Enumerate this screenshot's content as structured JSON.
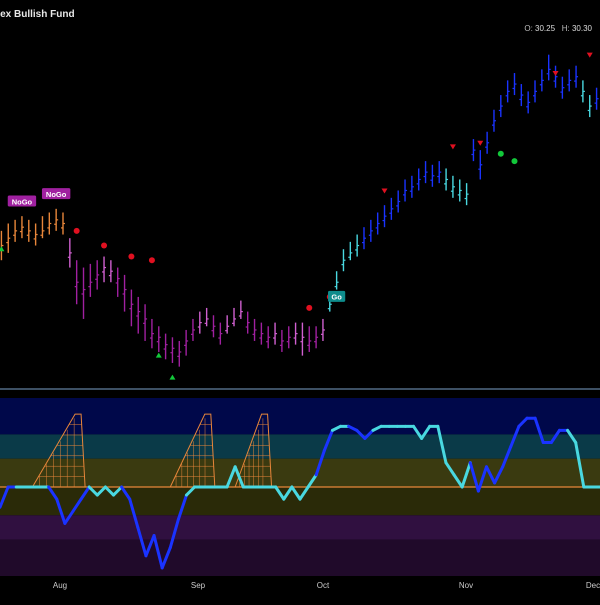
{
  "header": {
    "title": "dex Bullish Fund",
    "ohlc": {
      "o_label": "O:",
      "o_value": "30.25",
      "h_label": "H:",
      "h_value": "30.30"
    }
  },
  "colors": {
    "background": "#000000",
    "go_strong": "#1a33ff",
    "go_weak": "#49d8e0",
    "nogo_strong": "#a020a0",
    "nogo_weak": "#d060d0",
    "neutral": "#e8863a",
    "oscillator_zero": "#e8863a",
    "marker_red": "#e01020",
    "marker_green": "#12c83a",
    "divider": "#7aa0c8"
  },
  "chart_data": [
    {
      "type": "line",
      "x_tick_labels": [
        "Aug",
        "Sep",
        "Oct",
        "Nov",
        "Dec"
      ],
      "price_bars": [
        {
          "c": 14,
          "hi": 16,
          "lo": 12,
          "color": "neutral"
        },
        {
          "c": 15,
          "hi": 17,
          "lo": 13,
          "color": "neutral"
        },
        {
          "c": 16,
          "hi": 17.5,
          "lo": 14.5,
          "color": "neutral"
        },
        {
          "c": 16.5,
          "hi": 18,
          "lo": 15,
          "color": "neutral"
        },
        {
          "c": 16,
          "hi": 17.5,
          "lo": 14.5,
          "color": "neutral"
        },
        {
          "c": 15.5,
          "hi": 17,
          "lo": 14,
          "color": "neutral"
        },
        {
          "c": 16,
          "hi": 18,
          "lo": 15,
          "color": "neutral"
        },
        {
          "c": 17,
          "hi": 18.5,
          "lo": 15.5,
          "color": "neutral"
        },
        {
          "c": 17.5,
          "hi": 19,
          "lo": 16,
          "color": "neutral"
        },
        {
          "c": 17,
          "hi": 18.5,
          "lo": 15.5,
          "color": "neutral"
        },
        {
          "c": 13,
          "hi": 15,
          "lo": 11,
          "color": "nogo_weak"
        },
        {
          "c": 9,
          "hi": 12,
          "lo": 6,
          "color": "nogo_strong"
        },
        {
          "c": 8,
          "hi": 11,
          "lo": 4,
          "color": "nogo_strong"
        },
        {
          "c": 9,
          "hi": 11.5,
          "lo": 7,
          "color": "nogo_strong"
        },
        {
          "c": 10,
          "hi": 12,
          "lo": 8,
          "color": "nogo_strong"
        },
        {
          "c": 11,
          "hi": 12.5,
          "lo": 9,
          "color": "nogo_weak"
        },
        {
          "c": 10.5,
          "hi": 12,
          "lo": 9,
          "color": "nogo_weak"
        },
        {
          "c": 9.5,
          "hi": 11,
          "lo": 7,
          "color": "nogo_strong"
        },
        {
          "c": 8,
          "hi": 10,
          "lo": 5,
          "color": "nogo_strong"
        },
        {
          "c": 6,
          "hi": 8,
          "lo": 3,
          "color": "nogo_strong"
        },
        {
          "c": 5,
          "hi": 7,
          "lo": 2,
          "color": "nogo_strong"
        },
        {
          "c": 4,
          "hi": 6,
          "lo": 1,
          "color": "nogo_strong"
        },
        {
          "c": 2,
          "hi": 4,
          "lo": 0,
          "color": "nogo_strong"
        },
        {
          "c": 1.5,
          "hi": 3,
          "lo": -0.5,
          "color": "nogo_strong"
        },
        {
          "c": 0.5,
          "hi": 2,
          "lo": -1.5,
          "color": "nogo_strong"
        },
        {
          "c": 0,
          "hi": 1.5,
          "lo": -2,
          "color": "nogo_strong"
        },
        {
          "c": -0.5,
          "hi": 1,
          "lo": -2.5,
          "color": "nogo_strong"
        },
        {
          "c": 1,
          "hi": 2.5,
          "lo": -1,
          "color": "nogo_strong"
        },
        {
          "c": 2.5,
          "hi": 4,
          "lo": 1,
          "color": "nogo_strong"
        },
        {
          "c": 3.5,
          "hi": 5,
          "lo": 2,
          "color": "nogo_weak"
        },
        {
          "c": 4,
          "hi": 5.5,
          "lo": 3,
          "color": "nogo_weak"
        },
        {
          "c": 3,
          "hi": 4.5,
          "lo": 1.5,
          "color": "nogo_strong"
        },
        {
          "c": 2,
          "hi": 3.5,
          "lo": 0.5,
          "color": "nogo_strong"
        },
        {
          "c": 3,
          "hi": 4.5,
          "lo": 2,
          "color": "nogo_weak"
        },
        {
          "c": 4,
          "hi": 5.5,
          "lo": 3,
          "color": "nogo_weak"
        },
        {
          "c": 5,
          "hi": 6.5,
          "lo": 4,
          "color": "nogo_weak"
        },
        {
          "c": 3.5,
          "hi": 5,
          "lo": 2,
          "color": "nogo_strong"
        },
        {
          "c": 2.5,
          "hi": 4,
          "lo": 1,
          "color": "nogo_strong"
        },
        {
          "c": 2,
          "hi": 3.5,
          "lo": 0.5,
          "color": "nogo_strong"
        },
        {
          "c": 1.5,
          "hi": 3,
          "lo": 0,
          "color": "nogo_strong"
        },
        {
          "c": 2,
          "hi": 3.5,
          "lo": 0.5,
          "color": "nogo_weak"
        },
        {
          "c": 1,
          "hi": 2.5,
          "lo": -0.5,
          "color": "nogo_strong"
        },
        {
          "c": 1.5,
          "hi": 3,
          "lo": 0,
          "color": "nogo_strong"
        },
        {
          "c": 2,
          "hi": 3.5,
          "lo": 0.5,
          "color": "nogo_weak"
        },
        {
          "c": 1.5,
          "hi": 3.5,
          "lo": -1,
          "color": "nogo_weak"
        },
        {
          "c": 1,
          "hi": 3,
          "lo": -0.5,
          "color": "nogo_strong"
        },
        {
          "c": 1.5,
          "hi": 3,
          "lo": 0,
          "color": "nogo_strong"
        },
        {
          "c": 2.5,
          "hi": 4,
          "lo": 1,
          "color": "nogo_weak"
        },
        {
          "c": 6,
          "hi": 7.5,
          "lo": 5,
          "color": "go_weak"
        },
        {
          "c": 9,
          "hi": 10.5,
          "lo": 8,
          "color": "go_weak"
        },
        {
          "c": 12,
          "hi": 13.5,
          "lo": 10.5,
          "color": "go_weak"
        },
        {
          "c": 13,
          "hi": 14.5,
          "lo": 12,
          "color": "go_weak"
        },
        {
          "c": 14,
          "hi": 15.5,
          "lo": 12.5,
          "color": "go_weak"
        },
        {
          "c": 15,
          "hi": 16.5,
          "lo": 13.5,
          "color": "go_strong"
        },
        {
          "c": 16,
          "hi": 17.5,
          "lo": 14.5,
          "color": "go_strong"
        },
        {
          "c": 17,
          "hi": 18.5,
          "lo": 15.5,
          "color": "go_strong"
        },
        {
          "c": 18,
          "hi": 19.5,
          "lo": 16.5,
          "color": "go_strong"
        },
        {
          "c": 19,
          "hi": 20.5,
          "lo": 17.5,
          "color": "go_strong"
        },
        {
          "c": 20,
          "hi": 21.5,
          "lo": 18.5,
          "color": "go_strong"
        },
        {
          "c": 21.5,
          "hi": 23,
          "lo": 20,
          "color": "go_strong"
        },
        {
          "c": 22,
          "hi": 23.5,
          "lo": 20.5,
          "color": "go_strong"
        },
        {
          "c": 23,
          "hi": 24.5,
          "lo": 21.5,
          "color": "go_strong"
        },
        {
          "c": 24,
          "hi": 25.5,
          "lo": 22.5,
          "color": "go_strong"
        },
        {
          "c": 23.5,
          "hi": 25,
          "lo": 22,
          "color": "go_strong"
        },
        {
          "c": 24,
          "hi": 25.5,
          "lo": 22.5,
          "color": "go_strong"
        },
        {
          "c": 23,
          "hi": 24.5,
          "lo": 21.5,
          "color": "go_weak"
        },
        {
          "c": 22,
          "hi": 23.5,
          "lo": 20.5,
          "color": "go_weak"
        },
        {
          "c": 21.5,
          "hi": 23,
          "lo": 20,
          "color": "go_weak"
        },
        {
          "c": 21,
          "hi": 22.5,
          "lo": 19.5,
          "color": "go_weak"
        },
        {
          "c": 27,
          "hi": 28.5,
          "lo": 25.5,
          "color": "go_strong"
        },
        {
          "c": 25,
          "hi": 27,
          "lo": 23,
          "color": "go_strong"
        },
        {
          "c": 28,
          "hi": 29.5,
          "lo": 26.5,
          "color": "go_strong"
        },
        {
          "c": 31,
          "hi": 32.5,
          "lo": 29.5,
          "color": "go_strong"
        },
        {
          "c": 33,
          "hi": 34.5,
          "lo": 31.5,
          "color": "go_strong"
        },
        {
          "c": 35,
          "hi": 36.5,
          "lo": 33.5,
          "color": "go_strong"
        },
        {
          "c": 36,
          "hi": 37.5,
          "lo": 34.5,
          "color": "go_strong"
        },
        {
          "c": 34.5,
          "hi": 36,
          "lo": 33,
          "color": "go_strong"
        },
        {
          "c": 33.5,
          "hi": 35,
          "lo": 32,
          "color": "go_strong"
        },
        {
          "c": 35,
          "hi": 36.5,
          "lo": 33.5,
          "color": "go_strong"
        },
        {
          "c": 36.5,
          "hi": 38,
          "lo": 35,
          "color": "go_strong"
        },
        {
          "c": 38,
          "hi": 40,
          "lo": 36.5,
          "color": "go_strong"
        },
        {
          "c": 37,
          "hi": 38.5,
          "lo": 35.5,
          "color": "go_strong"
        },
        {
          "c": 35.5,
          "hi": 37,
          "lo": 34,
          "color": "go_strong"
        },
        {
          "c": 36.5,
          "hi": 38,
          "lo": 35,
          "color": "go_strong"
        },
        {
          "c": 37,
          "hi": 38.5,
          "lo": 35.5,
          "color": "go_strong"
        },
        {
          "c": 35,
          "hi": 36.5,
          "lo": 33.5,
          "color": "go_weak"
        },
        {
          "c": 33,
          "hi": 34.5,
          "lo": 31.5,
          "color": "go_weak"
        },
        {
          "c": 34,
          "hi": 35.5,
          "lo": 32.5,
          "color": "go_strong"
        }
      ],
      "labels": [
        {
          "text": "NoGo",
          "bar": 3,
          "price": 20,
          "color": "nogo_strong"
        },
        {
          "text": "NoGo",
          "bar": 8,
          "price": 21,
          "color": "nogo_strong"
        },
        {
          "text": "Go",
          "bar": 49,
          "price": 7,
          "color": "go_teal"
        }
      ],
      "markers": [
        {
          "bar": 11,
          "price": 16,
          "shape": "circle",
          "color": "marker_red"
        },
        {
          "bar": 15,
          "price": 14,
          "shape": "circle",
          "color": "marker_red"
        },
        {
          "bar": 19,
          "price": 12.5,
          "shape": "circle",
          "color": "marker_red"
        },
        {
          "bar": 22,
          "price": 12,
          "shape": "circle",
          "color": "marker_red"
        },
        {
          "bar": 45,
          "price": 5.5,
          "shape": "circle",
          "color": "marker_red"
        },
        {
          "bar": 48,
          "price": 7,
          "shape": "circle",
          "color": "marker_red"
        },
        {
          "bar": 56,
          "price": 21.5,
          "shape": "triangle-down",
          "color": "marker_red"
        },
        {
          "bar": 66,
          "price": 27.5,
          "shape": "triangle-down",
          "color": "marker_red"
        },
        {
          "bar": 70,
          "price": 28,
          "shape": "triangle-down",
          "color": "marker_red"
        },
        {
          "bar": 73,
          "price": 26.5,
          "shape": "circle",
          "color": "marker_green"
        },
        {
          "bar": 75,
          "price": 25.5,
          "shape": "circle",
          "color": "marker_green"
        },
        {
          "bar": 81,
          "price": 37.5,
          "shape": "triangle-down",
          "color": "marker_red"
        },
        {
          "bar": 86,
          "price": 40,
          "shape": "triangle-down",
          "color": "marker_red"
        },
        {
          "bar": 0,
          "price": 13.5,
          "shape": "triangle-up",
          "color": "marker_green"
        },
        {
          "bar": 23,
          "price": -1,
          "shape": "triangle-up",
          "color": "marker_green"
        },
        {
          "bar": 25,
          "price": -4,
          "shape": "triangle-up",
          "color": "marker_green"
        }
      ],
      "y_range": [
        -5,
        42
      ]
    },
    {
      "type": "line",
      "oscillator": [
        {
          "v": -0.5,
          "c": "go_strong"
        },
        {
          "v": 0,
          "c": "go_strong"
        },
        {
          "v": 0,
          "c": "go_strong"
        },
        {
          "v": 0,
          "c": "go_weak"
        },
        {
          "v": 0,
          "c": "go_weak"
        },
        {
          "v": 0,
          "c": "go_weak"
        },
        {
          "v": 0,
          "c": "go_weak"
        },
        {
          "v": -0.3,
          "c": "go_strong"
        },
        {
          "v": -0.9,
          "c": "go_strong"
        },
        {
          "v": -0.6,
          "c": "go_strong"
        },
        {
          "v": -0.3,
          "c": "go_strong"
        },
        {
          "v": 0,
          "c": "go_strong"
        },
        {
          "v": -0.2,
          "c": "go_weak"
        },
        {
          "v": 0,
          "c": "go_weak"
        },
        {
          "v": -0.2,
          "c": "go_weak"
        },
        {
          "v": 0,
          "c": "go_weak"
        },
        {
          "v": -0.3,
          "c": "go_strong"
        },
        {
          "v": -1.0,
          "c": "go_strong"
        },
        {
          "v": -1.7,
          "c": "go_strong"
        },
        {
          "v": -1.2,
          "c": "go_strong"
        },
        {
          "v": -2.0,
          "c": "go_strong"
        },
        {
          "v": -1.5,
          "c": "go_strong"
        },
        {
          "v": -0.8,
          "c": "go_strong"
        },
        {
          "v": -0.2,
          "c": "go_strong"
        },
        {
          "v": 0,
          "c": "go_weak"
        },
        {
          "v": 0,
          "c": "go_weak"
        },
        {
          "v": 0,
          "c": "go_weak"
        },
        {
          "v": 0,
          "c": "go_weak"
        },
        {
          "v": 0,
          "c": "go_weak"
        },
        {
          "v": 0.5,
          "c": "go_weak"
        },
        {
          "v": 0,
          "c": "go_weak"
        },
        {
          "v": 0,
          "c": "go_weak"
        },
        {
          "v": 0,
          "c": "go_weak"
        },
        {
          "v": 0,
          "c": "go_weak"
        },
        {
          "v": 0,
          "c": "go_weak"
        },
        {
          "v": -0.3,
          "c": "go_weak"
        },
        {
          "v": 0,
          "c": "go_weak"
        },
        {
          "v": -0.3,
          "c": "go_weak"
        },
        {
          "v": 0,
          "c": "go_weak"
        },
        {
          "v": 0.3,
          "c": "go_weak"
        },
        {
          "v": 0.9,
          "c": "go_strong"
        },
        {
          "v": 1.4,
          "c": "go_strong"
        },
        {
          "v": 1.5,
          "c": "go_weak"
        },
        {
          "v": 1.5,
          "c": "go_weak"
        },
        {
          "v": 1.4,
          "c": "go_strong"
        },
        {
          "v": 1.2,
          "c": "go_strong"
        },
        {
          "v": 1.4,
          "c": "go_strong"
        },
        {
          "v": 1.5,
          "c": "go_weak"
        },
        {
          "v": 1.5,
          "c": "go_weak"
        },
        {
          "v": 1.5,
          "c": "go_weak"
        },
        {
          "v": 1.5,
          "c": "go_weak"
        },
        {
          "v": 1.5,
          "c": "go_weak"
        },
        {
          "v": 1.2,
          "c": "go_weak"
        },
        {
          "v": 1.5,
          "c": "go_weak"
        },
        {
          "v": 1.5,
          "c": "go_weak"
        },
        {
          "v": 0.6,
          "c": "go_weak"
        },
        {
          "v": 0.3,
          "c": "go_weak"
        },
        {
          "v": 0,
          "c": "go_weak"
        },
        {
          "v": 0.6,
          "c": "go_weak"
        },
        {
          "v": -0.1,
          "c": "go_strong"
        },
        {
          "v": 0.5,
          "c": "go_strong"
        },
        {
          "v": 0.1,
          "c": "go_strong"
        },
        {
          "v": 0.5,
          "c": "go_strong"
        },
        {
          "v": 1.0,
          "c": "go_strong"
        },
        {
          "v": 1.5,
          "c": "go_strong"
        },
        {
          "v": 1.7,
          "c": "go_strong"
        },
        {
          "v": 1.7,
          "c": "go_strong"
        },
        {
          "v": 1.1,
          "c": "go_strong"
        },
        {
          "v": 1.1,
          "c": "go_strong"
        },
        {
          "v": 1.4,
          "c": "go_strong"
        },
        {
          "v": 1.4,
          "c": "go_strong"
        },
        {
          "v": 1.1,
          "c": "go_weak"
        },
        {
          "v": 0,
          "c": "go_weak"
        },
        {
          "v": 0,
          "c": "go_weak"
        },
        {
          "v": 0,
          "c": "go_weak"
        }
      ],
      "zones": [
        {
          "from": 1.3,
          "to": 2.5,
          "color": "#00084a"
        },
        {
          "from": 0.7,
          "to": 1.3,
          "color": "#0a3a48"
        },
        {
          "from": 0.0,
          "to": 0.7,
          "color": "#3a3a10"
        },
        {
          "from": -0.7,
          "to": 0.0,
          "color": "#2a2a08"
        },
        {
          "from": -1.3,
          "to": -0.7,
          "color": "#301040"
        },
        {
          "from": -2.5,
          "to": -1.3,
          "color": "#200a2a"
        }
      ],
      "y_range": [
        -2.2,
        2.2
      ],
      "x_tick_labels": [
        "Aug",
        "Sep",
        "Oct",
        "Nov",
        "Dec"
      ]
    }
  ]
}
